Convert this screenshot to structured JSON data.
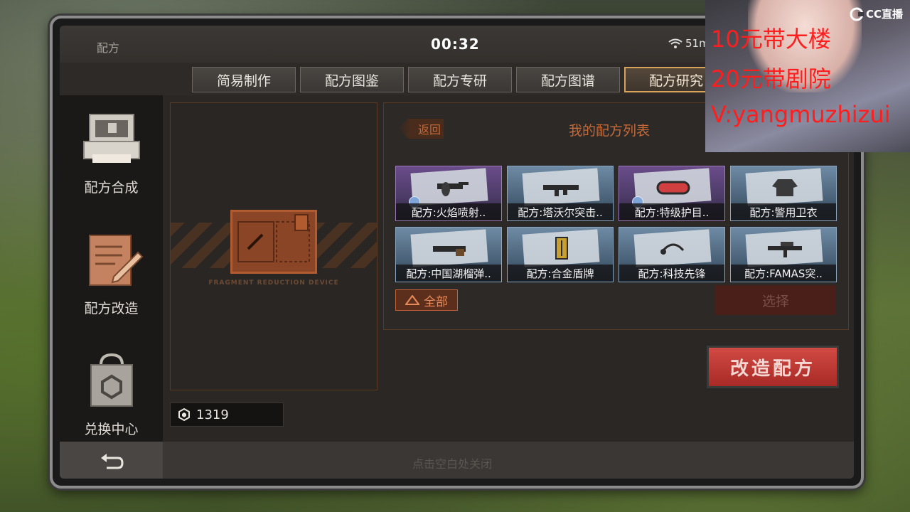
{
  "status": {
    "title": "配方",
    "clock": "00:32",
    "battery": "51m"
  },
  "tabs": [
    {
      "label": "简易制作"
    },
    {
      "label": "配方图鉴"
    },
    {
      "label": "配方专研"
    },
    {
      "label": "配方图谱"
    },
    {
      "label": "配方研究"
    }
  ],
  "active_tab": "配方研究",
  "sidebar": {
    "items": [
      {
        "label": "配方合成",
        "icon": "printer-icon"
      },
      {
        "label": "配方改造",
        "icon": "document-pen-icon"
      },
      {
        "label": "兑换中心",
        "icon": "shopping-bag-icon"
      }
    ]
  },
  "device": {
    "caption": "FRAGMENT REDUCTION DEVICE"
  },
  "currency": {
    "amount": "1319",
    "icon": "hexagon-coin-icon"
  },
  "recipe_list": {
    "back_label": "返回",
    "title": "我的配方列表",
    "items": [
      {
        "label": "配方:火焰喷射..",
        "rarity": "purple"
      },
      {
        "label": "配方:塔沃尔突击..",
        "rarity": "blue"
      },
      {
        "label": "配方:特级护目..",
        "rarity": "purple"
      },
      {
        "label": "配方:警用卫衣",
        "rarity": "blue"
      },
      {
        "label": "配方:中国湖榴弹..",
        "rarity": "blue"
      },
      {
        "label": "配方:合金盾牌",
        "rarity": "blue"
      },
      {
        "label": "配方:科技先锋",
        "rarity": "blue"
      },
      {
        "label": "配方:FAMAS突..",
        "rarity": "blue"
      }
    ],
    "all_label": "全部",
    "select_label": "选择"
  },
  "modify_button": "改造配方",
  "close_hint": "点击空白处关闭",
  "stream": {
    "logo": "CC直播",
    "overlay_lines": [
      "10元带大楼",
      "20元带剧院",
      "V:yangmuzhizui"
    ]
  },
  "colors": {
    "accent_orange": "#c46a3a",
    "modify_red": "#d24a44",
    "overlay_red": "#ff1e1e"
  }
}
